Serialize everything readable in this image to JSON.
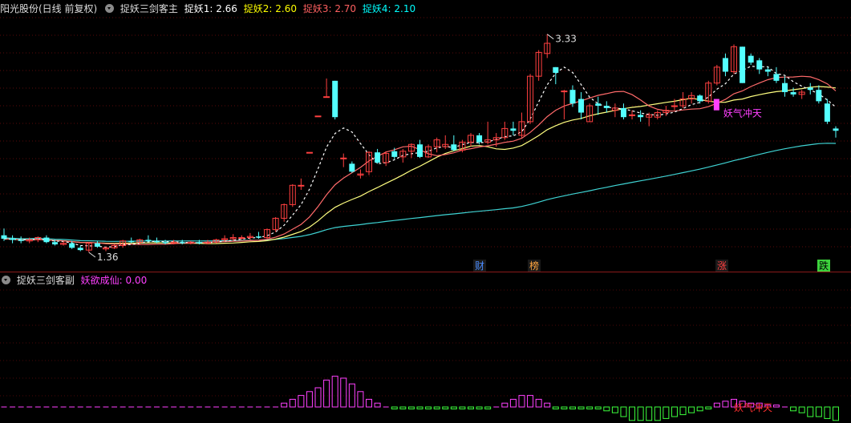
{
  "main_panel": {
    "stock_label": "阳光股份(日线 前复权)",
    "indicator_name": "捉妖三剑客主",
    "lines": [
      {
        "label": "捉妖1:",
        "value": "2.66",
        "color": "#ffffff"
      },
      {
        "label": "捉妖2:",
        "value": "2.60",
        "color": "#ffff00"
      },
      {
        "label": "捉妖3:",
        "value": "2.70",
        "color": "#ff6060"
      },
      {
        "label": "捉妖4:",
        "value": "2.10",
        "color": "#00ffff"
      }
    ],
    "high_label": "3.33",
    "low_label": "1.36",
    "signal_text": "妖气冲天",
    "event_tags": [
      {
        "text": "财",
        "color": "#4a8cff"
      },
      {
        "text": "榜",
        "color": "#ffa640"
      },
      {
        "text": "涨",
        "color": "#ff4040"
      },
      {
        "text": "跌",
        "color": "#000000"
      }
    ]
  },
  "sub_panel": {
    "indicator_name": "捉妖三剑客副",
    "line_label": "妖欲成仙:",
    "line_value": "0.00",
    "signal_text": "妖气冲天"
  },
  "colors": {
    "up": "#ff4040",
    "down": "#54ffff",
    "ma1": "#ffffff",
    "ma2": "#ffff80",
    "ma3": "#ff6a6a",
    "ma4": "#3fd3d3",
    "sub_up": "#ff40ff",
    "sub_down": "#3cff3c",
    "signal": "#ff40ff"
  },
  "chart_data": {
    "type": "candlestick",
    "price_range": [
      1.25,
      3.45
    ],
    "candles": [
      [
        1.52,
        1.58,
        1.47,
        1.49
      ],
      [
        1.49,
        1.52,
        1.45,
        1.48
      ],
      [
        1.48,
        1.51,
        1.45,
        1.47
      ],
      [
        1.47,
        1.5,
        1.45,
        1.48
      ],
      [
        1.48,
        1.51,
        1.46,
        1.5
      ],
      [
        1.5,
        1.52,
        1.45,
        1.46
      ],
      [
        1.46,
        1.48,
        1.43,
        1.44
      ],
      [
        1.44,
        1.47,
        1.43,
        1.45
      ],
      [
        1.45,
        1.47,
        1.4,
        1.41
      ],
      [
        1.41,
        1.43,
        1.38,
        1.39
      ],
      [
        1.39,
        1.46,
        1.37,
        1.45
      ],
      [
        1.45,
        1.47,
        1.41,
        1.42
      ],
      [
        1.4,
        1.42,
        1.38,
        1.41
      ],
      [
        1.41,
        1.44,
        1.4,
        1.43
      ],
      [
        1.43,
        1.48,
        1.41,
        1.47
      ],
      [
        1.47,
        1.5,
        1.45,
        1.46
      ],
      [
        1.46,
        1.49,
        1.44,
        1.48
      ],
      [
        1.48,
        1.52,
        1.46,
        1.47
      ],
      [
        1.47,
        1.5,
        1.45,
        1.46
      ],
      [
        1.46,
        1.48,
        1.44,
        1.45
      ],
      [
        1.45,
        1.48,
        1.44,
        1.46
      ],
      [
        1.46,
        1.48,
        1.44,
        1.45
      ],
      [
        1.45,
        1.47,
        1.44,
        1.46
      ],
      [
        1.46,
        1.48,
        1.44,
        1.45
      ],
      [
        1.45,
        1.48,
        1.44,
        1.46
      ],
      [
        1.46,
        1.49,
        1.45,
        1.48
      ],
      [
        1.48,
        1.52,
        1.46,
        1.49
      ],
      [
        1.49,
        1.53,
        1.47,
        1.5
      ],
      [
        1.5,
        1.52,
        1.48,
        1.5
      ],
      [
        1.5,
        1.54,
        1.48,
        1.51
      ],
      [
        1.51,
        1.55,
        1.49,
        1.5
      ],
      [
        1.5,
        1.58,
        1.49,
        1.57
      ],
      [
        1.57,
        1.68,
        1.55,
        1.67
      ],
      [
        1.67,
        1.8,
        1.64,
        1.79
      ],
      [
        1.79,
        1.97,
        1.77,
        1.96
      ],
      [
        1.96,
        2.02,
        1.92,
        1.96
      ],
      [
        2.25,
        2.25,
        2.25,
        2.25
      ],
      [
        2.57,
        2.57,
        2.57,
        2.57
      ],
      [
        2.74,
        2.9,
        2.74,
        2.74
      ],
      [
        2.88,
        2.88,
        2.54,
        2.56
      ],
      [
        2.2,
        2.24,
        2.12,
        2.2
      ],
      [
        2.15,
        2.17,
        2.07,
        2.08
      ],
      [
        2.05,
        2.1,
        2.02,
        2.06
      ],
      [
        2.08,
        2.26,
        2.05,
        2.25
      ],
      [
        2.25,
        2.28,
        2.15,
        2.16
      ],
      [
        2.16,
        2.26,
        2.13,
        2.24
      ],
      [
        2.26,
        2.29,
        2.19,
        2.21
      ],
      [
        2.21,
        2.28,
        2.16,
        2.26
      ],
      [
        2.26,
        2.33,
        2.2,
        2.32
      ],
      [
        2.32,
        2.36,
        2.2,
        2.21
      ],
      [
        2.21,
        2.32,
        2.2,
        2.3
      ],
      [
        2.3,
        2.38,
        2.25,
        2.36
      ],
      [
        2.3,
        2.4,
        2.28,
        2.32
      ],
      [
        2.32,
        2.4,
        2.26,
        2.27
      ],
      [
        2.27,
        2.36,
        2.25,
        2.34
      ],
      [
        2.34,
        2.42,
        2.3,
        2.4
      ],
      [
        2.4,
        2.42,
        2.32,
        2.34
      ],
      [
        2.34,
        2.52,
        2.32,
        2.36
      ],
      [
        2.36,
        2.42,
        2.3,
        2.38
      ],
      [
        2.38,
        2.52,
        2.36,
        2.46
      ],
      [
        2.46,
        2.52,
        2.4,
        2.44
      ],
      [
        2.4,
        2.6,
        2.38,
        2.52
      ],
      [
        2.52,
        2.94,
        2.5,
        2.92
      ],
      [
        2.92,
        3.15,
        2.88,
        3.13
      ],
      [
        3.12,
        3.29,
        3.08,
        3.21
      ],
      [
        3.0,
        3.0,
        2.85,
        2.95
      ],
      [
        2.79,
        2.8,
        2.54,
        2.79
      ],
      [
        2.8,
        2.84,
        2.65,
        2.68
      ],
      [
        2.72,
        2.78,
        2.54,
        2.6
      ],
      [
        2.52,
        2.68,
        2.52,
        2.66
      ],
      [
        2.68,
        2.74,
        2.58,
        2.66
      ],
      [
        2.66,
        2.7,
        2.6,
        2.64
      ],
      [
        2.62,
        2.68,
        2.56,
        2.64
      ],
      [
        2.64,
        2.68,
        2.54,
        2.56
      ],
      [
        2.58,
        2.62,
        2.54,
        2.58
      ],
      [
        2.58,
        2.62,
        2.52,
        2.56
      ],
      [
        2.56,
        2.6,
        2.48,
        2.58
      ],
      [
        2.56,
        2.62,
        2.54,
        2.6
      ],
      [
        2.6,
        2.66,
        2.57,
        2.62
      ],
      [
        2.66,
        2.72,
        2.62,
        2.66
      ],
      [
        2.66,
        2.78,
        2.64,
        2.72
      ],
      [
        2.72,
        2.78,
        2.68,
        2.75
      ],
      [
        2.75,
        2.76,
        2.68,
        2.7
      ],
      [
        2.7,
        2.88,
        2.68,
        2.86
      ],
      [
        2.86,
        3.02,
        2.84,
        3.0
      ],
      [
        3.08,
        3.12,
        2.92,
        2.96
      ],
      [
        2.96,
        3.2,
        2.94,
        3.18
      ],
      [
        3.18,
        3.18,
        2.86,
        2.86
      ],
      [
        3.1,
        3.12,
        3.02,
        3.04
      ],
      [
        3.06,
        3.08,
        2.94,
        2.98
      ],
      [
        2.98,
        3.0,
        2.92,
        2.96
      ],
      [
        2.94,
        3.0,
        2.86,
        2.88
      ],
      [
        2.86,
        2.92,
        2.74,
        2.78
      ],
      [
        2.78,
        2.82,
        2.74,
        2.76
      ],
      [
        2.76,
        2.8,
        2.72,
        2.78
      ],
      [
        2.82,
        2.86,
        2.76,
        2.8
      ],
      [
        2.8,
        2.84,
        2.68,
        2.7
      ],
      [
        2.68,
        2.72,
        2.5,
        2.52
      ],
      [
        2.46,
        2.48,
        2.38,
        2.44
      ]
    ],
    "sub_values": [
      0,
      0,
      0,
      0,
      0,
      0,
      0,
      0,
      0,
      0,
      0,
      0,
      0,
      0,
      0,
      0,
      0,
      0,
      0,
      0,
      0,
      0,
      0,
      0,
      0,
      0,
      0,
      0,
      0,
      0,
      0,
      0,
      0,
      2,
      4,
      6,
      8,
      10,
      14,
      16,
      15,
      12,
      8,
      4,
      2,
      0,
      -1,
      -1,
      -1,
      -1,
      -1,
      -1,
      -1,
      -1,
      -1,
      -1,
      -1,
      -1,
      0,
      2,
      4,
      6,
      6,
      4,
      2,
      -1,
      -1,
      -1,
      -1,
      -1,
      -1,
      -2,
      -3,
      -5,
      -7,
      -7,
      -7,
      -7,
      -6,
      -5,
      -4,
      -3,
      -2,
      -1,
      2,
      3,
      4,
      3,
      2,
      2,
      1,
      1,
      0,
      -2,
      -3,
      -5,
      -5,
      -6,
      -7
    ]
  }
}
